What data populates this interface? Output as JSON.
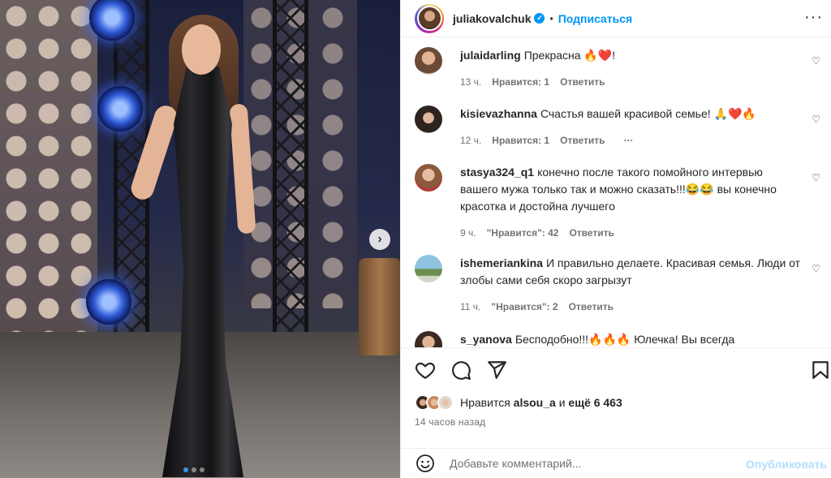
{
  "post": {
    "username": "juliakovalchuk",
    "separator": "•",
    "follow_label": "Подписаться",
    "more_label": "···",
    "carousel_next_label": "›",
    "carousel_dots": 3,
    "carousel_active_index": 0
  },
  "comments": [
    {
      "user": "julaidarling",
      "text": "Прекрасна 🔥❤️!",
      "time": "13 ч.",
      "likes": "Нравится: 1",
      "reply": "Ответить",
      "more": ""
    },
    {
      "user": "kisievazhanna",
      "text": "Счастья вашей красивой семье! 🙏❤️🔥",
      "time": "12 ч.",
      "likes": "Нравится: 1",
      "reply": "Ответить",
      "more": "···"
    },
    {
      "user": "stasya324_q1",
      "text": "конечно после такого помойного интервью вашего мужа только так и можно сказать!!!😂😂 вы конечно красотка и достойна лучшего",
      "time": "9 ч.",
      "likes": "\"Нравится\": 42",
      "reply": "Ответить",
      "more": ""
    },
    {
      "user": "ishemeriankina",
      "text": "И правильно делаете. Красивая семья. Люди от злобы сами себя скоро загрызут",
      "time": "11 ч.",
      "likes": "\"Нравится\": 2",
      "reply": "Ответить",
      "more": ""
    },
    {
      "user": "s_yanova",
      "text": "Бесподобно!!!🔥🔥🔥 Юлечка! Вы всегда",
      "time": "",
      "likes": "",
      "reply": "",
      "more": ""
    }
  ],
  "likes": {
    "prefix": "Нравится",
    "user": "alsou_a",
    "mid": " и ",
    "count": "ещё 6 463"
  },
  "posted_ago": "14 часов назад",
  "add_comment": {
    "placeholder": "Добавьте комментарий...",
    "publish_label": "Опубликовать"
  },
  "colors": {
    "accent": "#0095f6",
    "muted": "#737373",
    "publish_disabled": "#b2dffc",
    "text": "#262626"
  },
  "icons": [
    "verified-badge-icon",
    "more-options-icon",
    "heart-icon",
    "comment-icon",
    "share-icon",
    "bookmark-icon",
    "emoji-icon",
    "chevron-right-icon"
  ]
}
